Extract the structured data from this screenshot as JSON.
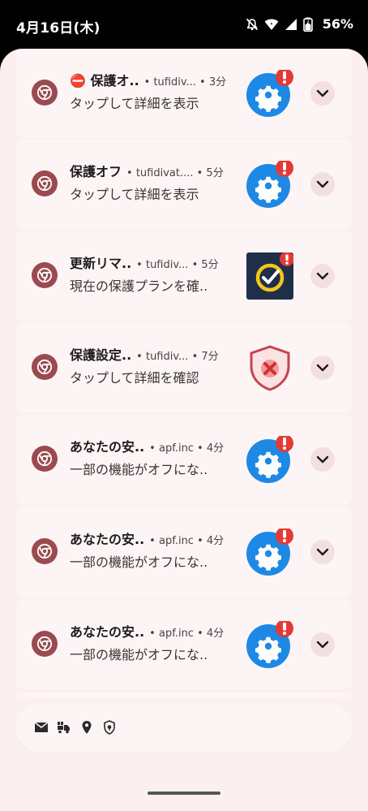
{
  "status_bar": {
    "time": "4月16日(木)",
    "battery": "56%",
    "icons": [
      "mute-icon",
      "wifi-icon",
      "signal-icon",
      "battery-charging-icon"
    ]
  },
  "notifications": [
    {
      "title": "⛔ 保護オ..",
      "meta": "• tufidiv... • 3分",
      "body": "タップして詳細を表示",
      "large_icon": "gear-alert-icon"
    },
    {
      "title": "保護オフ",
      "meta": "• tufidivat.... • 5分",
      "body": "タップして詳細を表示",
      "large_icon": "gear-alert-icon"
    },
    {
      "title": "更新リマ..",
      "meta": "• tufidiv... • 5分",
      "body": "現在の保護プランを確..",
      "large_icon": "norton-alert-icon"
    },
    {
      "title": "保護設定..",
      "meta": "• tufidiv... • 7分",
      "body": "タップして詳細を確認",
      "large_icon": "shield-x-icon"
    },
    {
      "title": "あなたの安..",
      "meta": "• apf.inc • 4分",
      "body": "一部の機能がオフにな..",
      "large_icon": "gear-alert-icon"
    },
    {
      "title": "あなたの安..",
      "meta": "• apf.inc • 4分",
      "body": "一部の機能がオフにな..",
      "large_icon": "gear-alert-icon"
    },
    {
      "title": "あなたの安..",
      "meta": "• apf.inc • 4分",
      "body": "一部の機能がオフにな..",
      "large_icon": "gear-alert-icon"
    }
  ],
  "silent_icons": [
    "mail-icon",
    "delivery-truck-icon",
    "location-pin-icon",
    "shield-lock-icon"
  ],
  "colors": {
    "shade_bg": "#fcefef",
    "card_bg": "#fdf5f5",
    "app_icon": "#9b4a50",
    "gear_blue": "#1e88e5",
    "alert_red": "#e53935"
  }
}
